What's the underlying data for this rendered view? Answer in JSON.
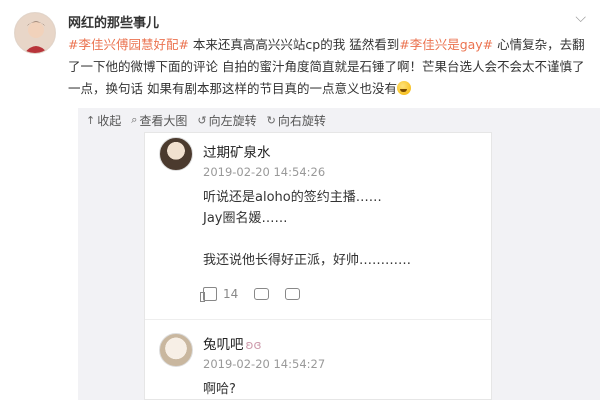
{
  "post": {
    "username": "网红的那些事儿",
    "text_parts": [
      {
        "t": "#李佳兴傅园慧好配#",
        "tag": true
      },
      {
        "t": " 本来还真高高兴兴站cp的我 猛然看到",
        "tag": false
      },
      {
        "t": "#李佳兴是gay#",
        "tag": true
      },
      {
        "t": " 心情复杂，去翻了一下他的微博下面的评论 自拍的蜜汁角度简直就是石锤了啊！芒果台选人会不会太不谨慎了一点，换句话 如果有剧本那这样的节目真的一点意义也没有",
        "tag": false
      }
    ]
  },
  "toolbar": {
    "collapse_label": "收起",
    "view_large_label": "查看大图",
    "rotate_left_label": "向左旋转",
    "rotate_right_label": "向右旋转"
  },
  "comments": [
    {
      "name": "过期矿泉水",
      "time": "2019-02-20 14:54:26",
      "body": "听说还是aloho的签约主播……\nJay圈名媛……\n\n我还说他长得好正派，好帅…………",
      "likes": "14"
    },
    {
      "name": "兔叽吧",
      "time": "2019-02-20 14:54:27",
      "body": "啊哈?"
    }
  ],
  "icons": {
    "more": "chevron-down-icon",
    "collapse": "up-arrow-icon",
    "zoom": "magnifier-icon",
    "rotate_left": "rotate-left-icon",
    "rotate_right": "rotate-right-icon"
  },
  "colors": {
    "tag": "#eb7350",
    "background": "#f2f2f5"
  }
}
